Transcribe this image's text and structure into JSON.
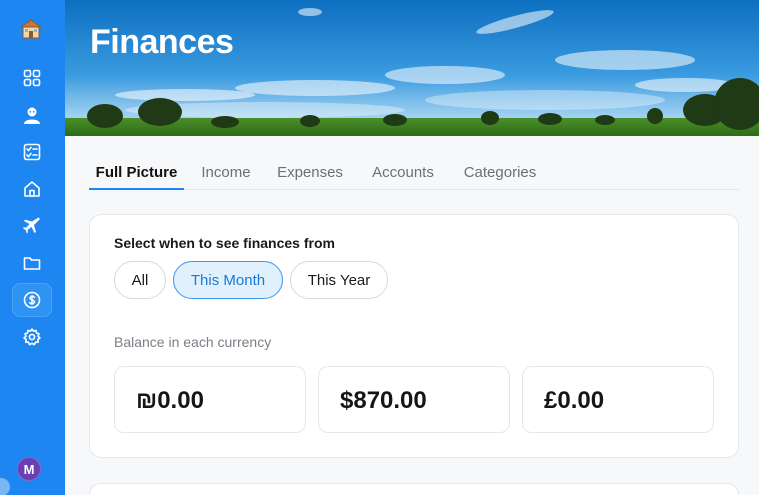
{
  "header": {
    "title": "Finances"
  },
  "tabs": [
    {
      "label": "Full Picture"
    },
    {
      "label": "Income"
    },
    {
      "label": "Expenses"
    },
    {
      "label": "Accounts"
    },
    {
      "label": "Categories"
    }
  ],
  "filter": {
    "label": "Select when to see finances from",
    "options": [
      {
        "label": "All"
      },
      {
        "label": "This Month"
      },
      {
        "label": "This Year"
      }
    ],
    "selected": "This Month"
  },
  "balances": {
    "label": "Balance in each currency",
    "items": [
      {
        "amount": "₪0.00"
      },
      {
        "amount": "$870.00"
      },
      {
        "amount": "£0.00"
      }
    ]
  },
  "user": {
    "initial": "M"
  },
  "colors": {
    "sidebar": "#1d86f0",
    "accent": "#1d86f0",
    "chip_active_bg": "#e1f0fd"
  },
  "icons": [
    "home-logo-icon",
    "dashboard-icon",
    "user-icon",
    "checklist-icon",
    "house-icon",
    "plane-icon",
    "folder-icon",
    "dollar-icon",
    "settings-icon"
  ]
}
